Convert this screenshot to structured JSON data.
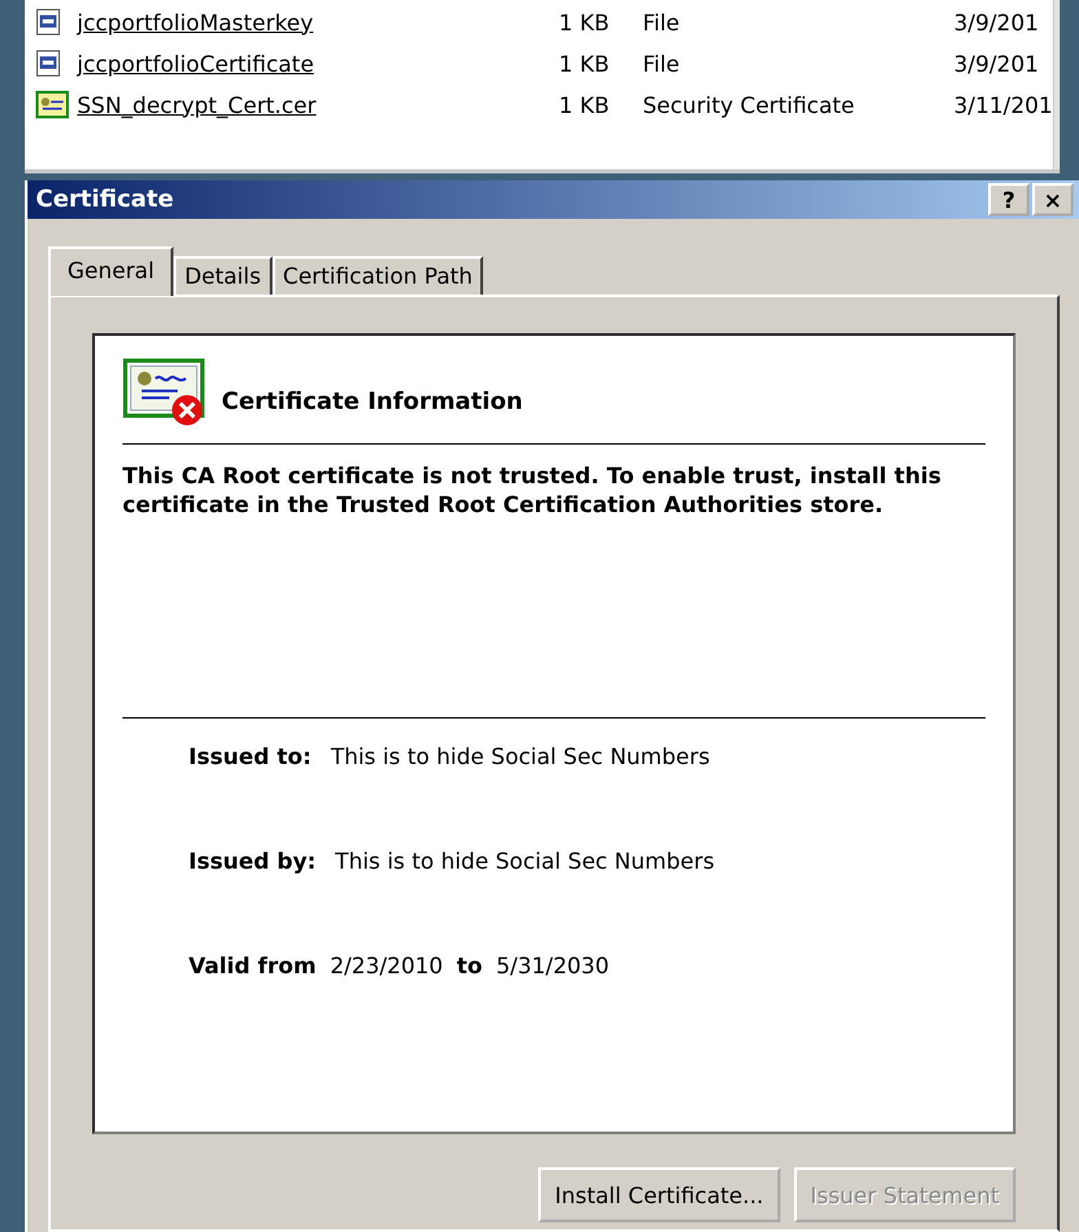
{
  "file_list": {
    "rows": [
      {
        "kind": "file",
        "name": "jccportfolioMasterkey",
        "size": "1 KB",
        "type": "File",
        "date": "3/9/201"
      },
      {
        "kind": "file",
        "name": "jccportfolioCertificate",
        "size": "1 KB",
        "type": "File",
        "date": "3/9/201"
      },
      {
        "kind": "certificate",
        "name": "SSN_decrypt_Cert.cer",
        "size": "1 KB",
        "type": "Security Certificate",
        "date": "3/11/201"
      }
    ]
  },
  "dialog": {
    "title": "Certificate",
    "title_buttons": [
      "?",
      "×"
    ],
    "tabs": [
      {
        "label": "General",
        "selected": true
      },
      {
        "label": "Details",
        "selected": false
      },
      {
        "label": "Certification Path",
        "selected": false
      }
    ],
    "info": {
      "heading": "Certificate Information",
      "message": "This CA Root certificate is not trusted. To enable trust, install this certificate in the Trusted Root Certification Authorities store.",
      "issued_to": {
        "label": "Issued to:",
        "value": "This is to hide Social Sec Numbers"
      },
      "issued_by": {
        "label": "Issued by:",
        "value": "This is to hide Social Sec Numbers"
      },
      "valid": {
        "from_label": "Valid from",
        "from": "2/23/2010",
        "to_label": "to",
        "to": "5/31/2030"
      }
    },
    "buttons": [
      {
        "label": "Install Certificate...",
        "disabled": false
      },
      {
        "label": "Issuer Statement",
        "disabled": true
      }
    ]
  }
}
